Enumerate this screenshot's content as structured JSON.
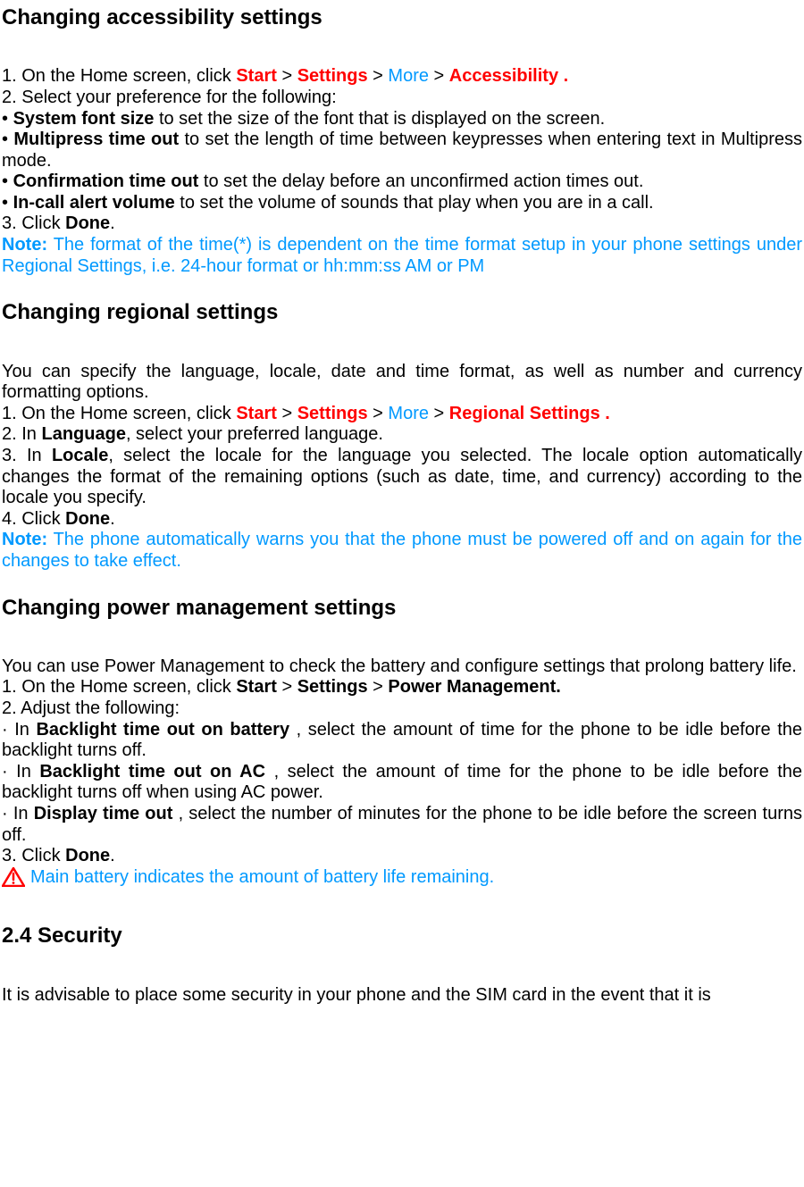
{
  "s1": {
    "heading": "Changing accessibility settings",
    "l1a": "1. On the Home screen, click ",
    "start": "Start",
    "gt": " > ",
    "settings": "Settings",
    "more": "More",
    "acc": "Accessibility .",
    "l2": "2. Select your preference for the following:",
    "b1a": "• ",
    "sfs": "System font size",
    "b1b": " to set the size of the font that is displayed on the screen.",
    "b2a": "• ",
    "mto": "Multipress time out",
    "b2b": " to set the length of time between keypresses when entering text in Multipress mode.",
    "b3a": "• ",
    "cto": "Confirmation time out",
    "b3b": " to set the delay before an unconfirmed action times out.",
    "b4a": "• ",
    "iav": "In-call alert volume",
    "b4b": " to set the volume of sounds that play when you are in a call.",
    "l3a": "3. Click ",
    "done": "Done",
    "period": ".",
    "note_label": "Note:",
    "note_body": " The format of the time(*) is dependent on the time format setup in your phone settings under Regional Settings, i.e. 24-hour format or hh:mm:ss AM or PM"
  },
  "s2": {
    "heading": "Changing regional settings",
    "intro": "You can specify the language, locale, date and time format, as well as number and currency formatting options.",
    "l1a": "1. On the Home screen, click ",
    "start": "Start",
    "gt": " > ",
    "settings": "Settings",
    "more": "More",
    "rs": "Regional Settings .",
    "l2a": "2. In ",
    "lang": "Language",
    "l2b": ", select your preferred language.",
    "l3a": "3. In ",
    "locale": "Locale",
    "l3b": ", select the locale for the language you selected. The locale option automatically changes the format of the remaining options (such as date, time, and currency) according to the locale you specify.",
    "l4a": "4. Click ",
    "done": "Done",
    "period": ".",
    "note_label": "Note:",
    "note_body": " The phone automatically warns you that the phone must be powered off and on again for the changes to take effect."
  },
  "s3": {
    "heading": "Changing power management settings",
    "intro": "You can use Power Management to check the battery and configure settings that prolong battery life.",
    "l1a": "1. On the Home screen, click ",
    "start": "Start",
    "gt": " > ",
    "settings": "Settings",
    "pm": "Power Management.",
    "l2": "2. Adjust the following:",
    "b1a": "· In ",
    "btob": "Backlight time out on battery ",
    "b1b": ", select the amount of time for the phone to be idle before the backlight turns off.",
    "b2a": "· In ",
    "btoa": "Backlight time out on AC ",
    "b2b": ", select the amount of time for the phone to be idle before the backlight turns off when using AC power.",
    "b3a": "· In ",
    "dto": "Display time out ",
    "b3b": ", select the number of minutes for the phone to be idle before the screen turns off.",
    "l3a": "3. Click ",
    "done": "Done",
    "period": ".",
    "warn": " Main battery indicates the amount of battery life remaining."
  },
  "s4": {
    "heading": "2.4 Security",
    "intro": "It is advisable to place some security in your phone and the SIM card in the event that it is"
  }
}
